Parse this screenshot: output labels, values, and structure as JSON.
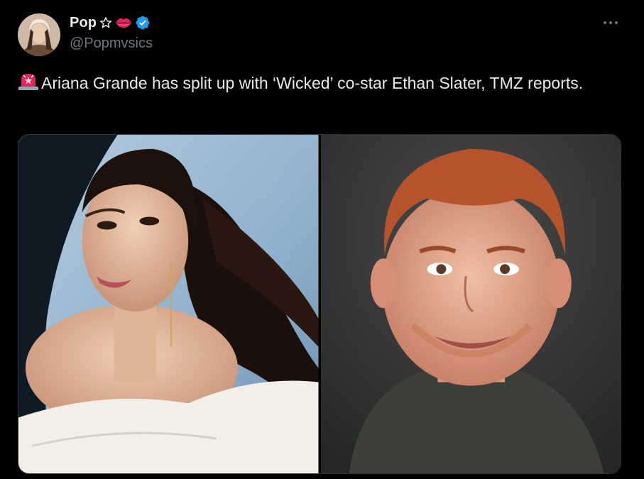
{
  "tweet": {
    "author": {
      "display_name": "Pop",
      "handle": "@Popmvsics",
      "verified": true,
      "avatar_icon": "avatar-photo",
      "name_icons": [
        "star-outline-icon",
        "lips-icon",
        "verified-badge-icon"
      ]
    },
    "text": "Ariana Grande has split up with ‘Wicked’ co-star Ethan Slater, TMZ reports.",
    "text_prefix_icon": "siren-icon",
    "more_icon": "more-horizontal-icon",
    "media": [
      {
        "type": "photo",
        "icon": "photo-left"
      },
      {
        "type": "photo",
        "icon": "photo-right"
      }
    ]
  },
  "colors": {
    "background": "#000000",
    "text": "#e7e9ea",
    "secondary_text": "#71767b",
    "verified": "#1d9bf0",
    "lips": "#e0245e",
    "border": "#2f3336"
  }
}
